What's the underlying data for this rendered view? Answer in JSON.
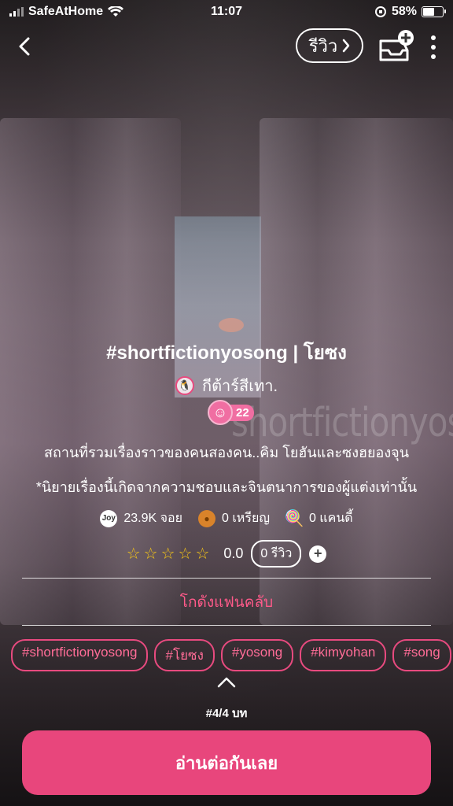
{
  "status_bar": {
    "carrier": "SafeAtHome",
    "time": "11:07",
    "battery": "58%"
  },
  "topbar": {
    "review_label": "รีวิว"
  },
  "story": {
    "title": "#shortfictionyosong | โยซง",
    "author": "กีต้าร์สีเทา.",
    "level": "22",
    "watermark": "shortfictionyosong",
    "description_line1": "สถานที่รวมเรื่องราวของคนสองคน..คิม โยฮันและซงฮยองจุน",
    "description_line2": "*นิยายเรื่องนี้เกิดจากความชอบและจินตนาการของผู้แต่งเท่านั้น"
  },
  "stats": {
    "views": "23.9K จอย",
    "coins": "0 เหรียญ",
    "candies": "0 แคนดี้"
  },
  "rating": {
    "value": "0.0",
    "reviews": "0 รีวิว"
  },
  "fanclub_label": "โกดังแฟนคลับ",
  "tags": [
    "#shortfictionyosong",
    "#โยซง",
    "#yosong",
    "#kimyohan",
    "#song"
  ],
  "chapter": "#4/4 บท",
  "read_button": "อ่านต่อกันเลย"
}
